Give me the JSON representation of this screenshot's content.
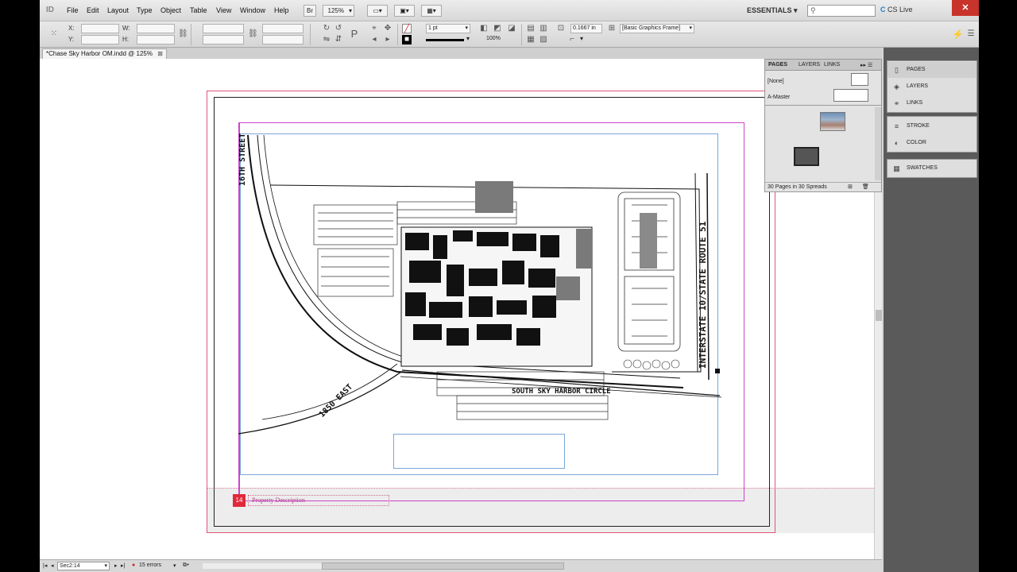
{
  "menubar": {
    "logo": "ID",
    "items": [
      "File",
      "Edit",
      "Layout",
      "Type",
      "Object",
      "Table",
      "View",
      "Window",
      "Help"
    ],
    "zoom": "125%",
    "workspace": "ESSENTIALS",
    "cs_live": "CS Live"
  },
  "control": {
    "x_label": "X:",
    "y_label": "Y:",
    "w_label": "W:",
    "h_label": "H:",
    "stroke_weight": "1 pt",
    "opacity": "100%",
    "offset": "0.1667 in",
    "object_style": "[Basic Graphics Frame]"
  },
  "document": {
    "tab_title": "*Chase Sky Harbor OM.indd @ 125%"
  },
  "map": {
    "street_north": "16TH STREET",
    "street_east": "INTERSTATE 10/STATE ROUTE 51",
    "street_south": "SOUTH SKY HARBOR CIRCLE",
    "street_southwest": "1850 EAST"
  },
  "footer": {
    "page_number": "14",
    "section_title": "Property Description"
  },
  "pages_panel": {
    "tabs": [
      "PAGES",
      "LAYERS",
      "LINKS"
    ],
    "none_label": "[None]",
    "master_label": "A-Master",
    "summary": "30 Pages in 30 Spreads"
  },
  "dock": {
    "group1": [
      "PAGES",
      "LAYERS",
      "LINKS"
    ],
    "group2": [
      "STROKE",
      "COLOR"
    ],
    "group3": [
      "SWATCHES"
    ]
  },
  "statusbar": {
    "page_field": "Sec2:14",
    "errors": "15 errors"
  },
  "colors": {
    "margin_magenta": "#cc44cc",
    "bleed_red": "#e0577a",
    "page_number_bg": "#e0293a",
    "frame_blue": "#7aa6d6",
    "error_red": "#d42020"
  }
}
